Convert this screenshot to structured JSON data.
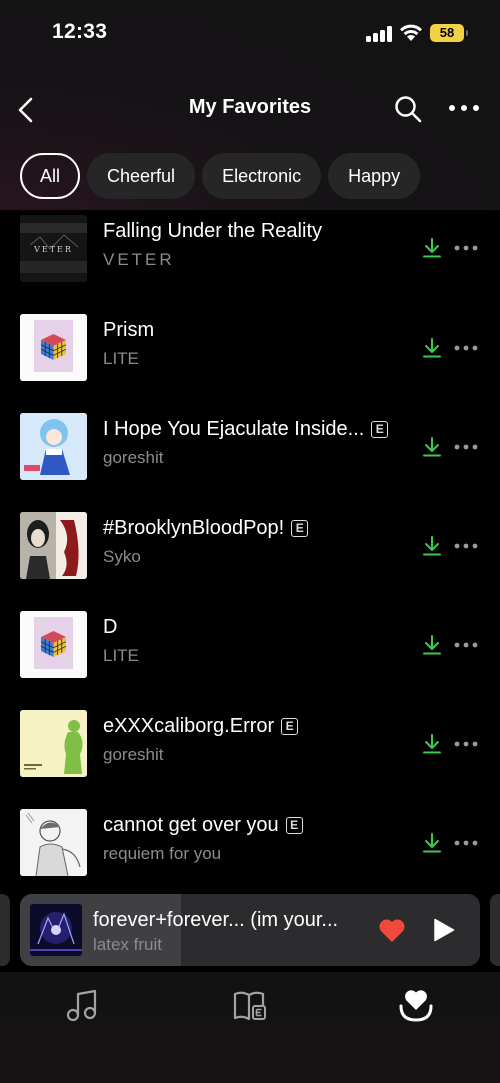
{
  "status_bar": {
    "time": "12:33",
    "battery": "58"
  },
  "nav": {
    "title": "My Favorites",
    "back_icon": "chevron-left-icon",
    "search_icon": "search-icon",
    "more_icon": "more-horizontal-icon"
  },
  "filters": [
    {
      "label": "All",
      "active": true
    },
    {
      "label": "Cheerful",
      "active": false
    },
    {
      "label": "Electronic",
      "active": false
    },
    {
      "label": "Happy",
      "active": false
    }
  ],
  "tracks": [
    {
      "title": "Falling Under the Reality",
      "artist": "VETER",
      "explicit": false
    },
    {
      "title": "Prism",
      "artist": "LITE",
      "explicit": false
    },
    {
      "title": "I Hope You Ejaculate Inside...",
      "artist": "goreshit",
      "explicit": true
    },
    {
      "title": "#BrooklynBloodPop!",
      "artist": "Syko",
      "explicit": true
    },
    {
      "title": "D",
      "artist": "LITE",
      "explicit": false
    },
    {
      "title": "eXXXcaliborg.Error",
      "artist": "goreshit",
      "explicit": true
    },
    {
      "title": "cannot get over you",
      "artist": "requiem for you",
      "explicit": true
    }
  ],
  "explicit_badge": "E",
  "cover_text": {
    "veter": "VETER"
  },
  "now_playing": {
    "title": "forever+forever... (im your...",
    "artist": "latex fruit",
    "liked": true,
    "progress": 0.35
  },
  "tabs": [
    {
      "name": "music-notes-icon"
    },
    {
      "name": "library-book-icon"
    },
    {
      "name": "favorites-heart-icon",
      "active": true
    }
  ],
  "colors": {
    "accent_green": "#3ec94f",
    "heart_red": "#ef4a3b",
    "battery_yellow": "#f3d145",
    "chip_bg": "#262626",
    "secondary_text": "#8c8c8c"
  }
}
